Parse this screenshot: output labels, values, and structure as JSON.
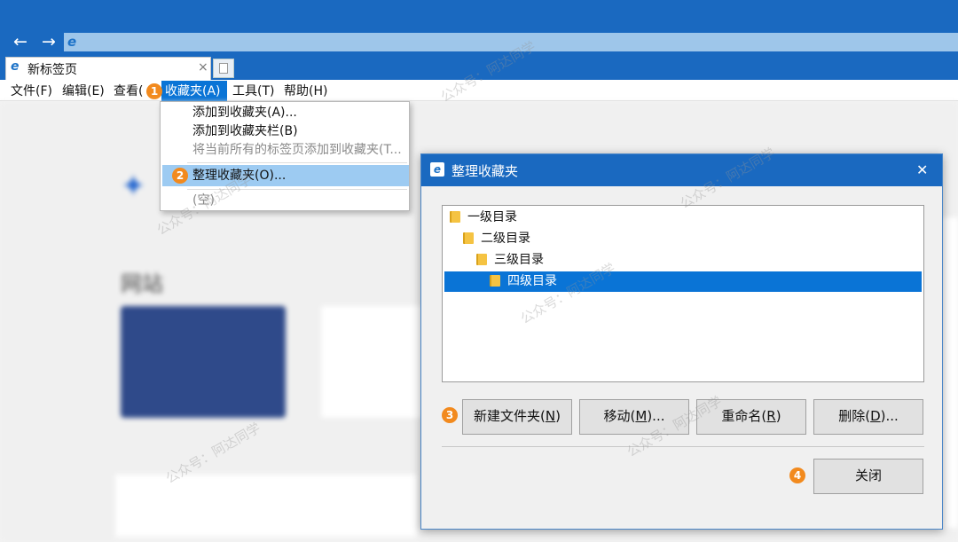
{
  "browser": {
    "tab_title": "新标签页",
    "tab_close": "×"
  },
  "menubar": {
    "items": [
      "文件(F)",
      "编辑(E)",
      "查看(",
      "收藏夹(A)",
      "工具(T)",
      "帮助(H)"
    ]
  },
  "favorites_menu": {
    "add_to_favorites": "添加到收藏夹(A)...",
    "add_to_bar": "添加到收藏夹栏(B)",
    "add_all_tabs": "将当前所有的标签页添加到收藏夹(T...",
    "organize": "整理收藏夹(O)...",
    "empty": "(空)"
  },
  "dialog": {
    "title": "整理收藏夹",
    "close_x": "✕",
    "tree": [
      "一级目录",
      "二级目录",
      "三级目录",
      "四级目录"
    ],
    "buttons": {
      "new_folder": "新建文件夹",
      "new_folder_key": "N",
      "move": "移动",
      "move_key": "M",
      "rename": "重命名",
      "rename_key": "R",
      "delete": "删除",
      "delete_key": "D",
      "close": "关闭"
    }
  },
  "steps": [
    "1",
    "2",
    "3",
    "4"
  ],
  "blurred_page": {
    "section_title": "网站"
  },
  "watermark": "公众号：阿达同学",
  "colors": {
    "chrome_blue": "#1a69c0",
    "badge_orange": "#f28a1e",
    "selection": "#0a74d6"
  }
}
